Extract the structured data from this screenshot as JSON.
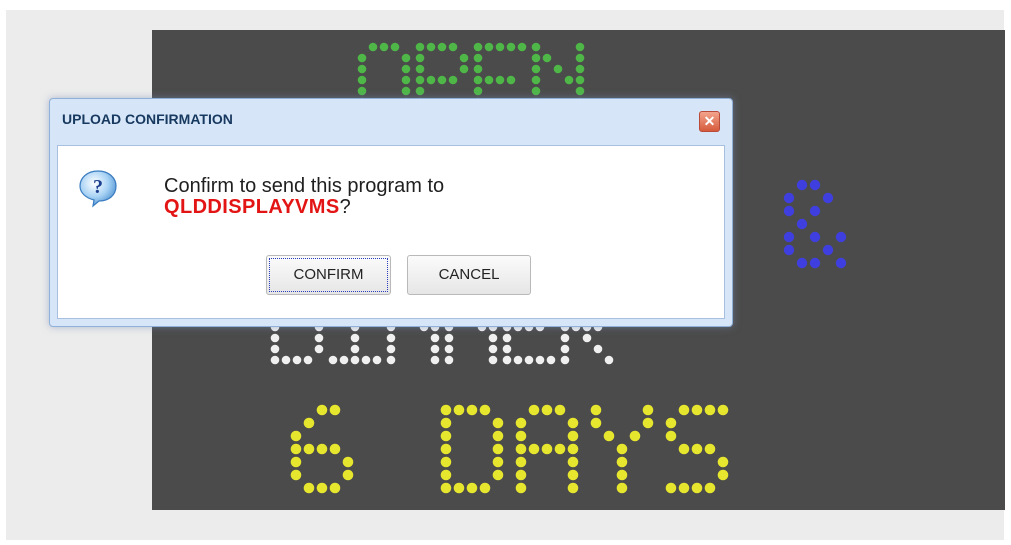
{
  "dialog": {
    "title": "UPLOAD CONFIRMATION",
    "message": "Confirm to send this program to",
    "device_name": "QLDDISPLAYVMS",
    "message_suffix": "?",
    "confirm_label": "CONFIRM",
    "cancel_label": "CANCEL",
    "icon": "question-icon",
    "close_icon": "close-icon"
  },
  "sign": {
    "lines": [
      "OPEN",
      "&",
      "DINNER",
      "6 DAYS"
    ],
    "colors": {
      "line1": "#4fb748",
      "line2": "#3f3fe0",
      "line3": "#f0f0f0",
      "line4": "#e6e62e"
    }
  }
}
